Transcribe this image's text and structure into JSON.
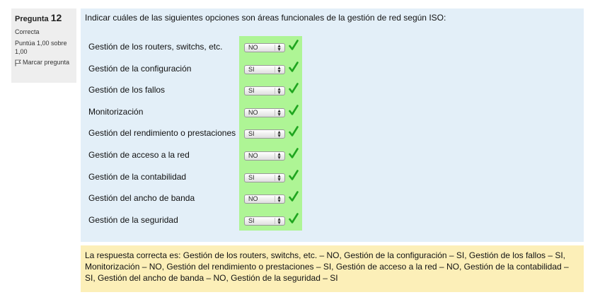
{
  "info": {
    "question_label": "Pregunta",
    "question_number": "12",
    "state": "Correcta",
    "grade": "Puntúa 1,00 sobre 1,00",
    "flag_label": "Marcar pregunta",
    "flag_icon": "flag-icon"
  },
  "question": {
    "text": "Indicar cuáles de las siguientes opciones son áreas funcionales de la gestión de red según ISO:",
    "rows": [
      {
        "label": "Gestión de los routers, switchs, etc.",
        "selected": "NO",
        "correct": true
      },
      {
        "label": "Gestión de la configuración",
        "selected": "SI",
        "correct": true
      },
      {
        "label": "Gestión de los fallos",
        "selected": "SI",
        "correct": true
      },
      {
        "label": "Monitorización",
        "selected": "NO",
        "correct": true
      },
      {
        "label": "Gestión del rendimiento o prestaciones",
        "selected": "SI",
        "correct": true
      },
      {
        "label": "Gestión de acceso a la red",
        "selected": "NO",
        "correct": true
      },
      {
        "label": "Gestión de la contabilidad",
        "selected": "SI",
        "correct": true
      },
      {
        "label": "Gestión del ancho de banda",
        "selected": "NO",
        "correct": true
      },
      {
        "label": "Gestión de la seguridad",
        "selected": "SI",
        "correct": true
      }
    ],
    "correct_icon": "checkmark-icon"
  },
  "right_answer": {
    "text": "La respuesta correcta es: Gestión de los routers, switchs, etc. – NO, Gestión de la configuración – SI, Gestión de los fallos – SI, Monitorización – NO, Gestión del rendimiento o prestaciones – SI, Gestión de acceso a la red – NO, Gestión de la contabilidad – SI, Gestión del ancho de banda – NO, Gestión de la seguridad – SI"
  },
  "colors": {
    "info_bg": "#eeeeee",
    "formulation_bg": "#e3eff8",
    "correct_highlight": "#aef595",
    "checkmark": "#1fa51f",
    "right_answer_bg": "#fcefb8"
  }
}
